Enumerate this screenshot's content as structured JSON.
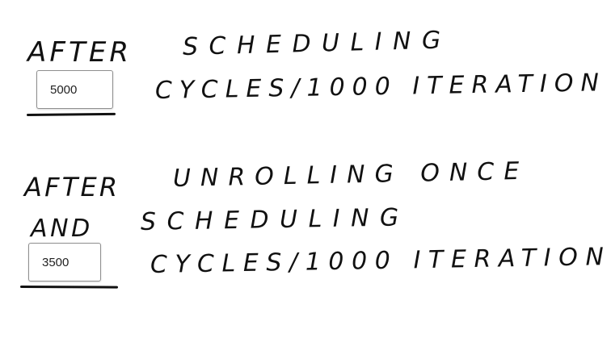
{
  "section1": {
    "after_label": "AFTER",
    "line1": "SCHEDULING",
    "line2": "CYCLES/1000 ITERATION",
    "cycles_value": "5000"
  },
  "section2": {
    "after_label": "AFTER",
    "and_label": "AND",
    "line1": "UNROLLING ONCE",
    "line2": "SCHEDULING",
    "line3": "CYCLES/1000 ITERATION",
    "cycles_value": "3500"
  }
}
